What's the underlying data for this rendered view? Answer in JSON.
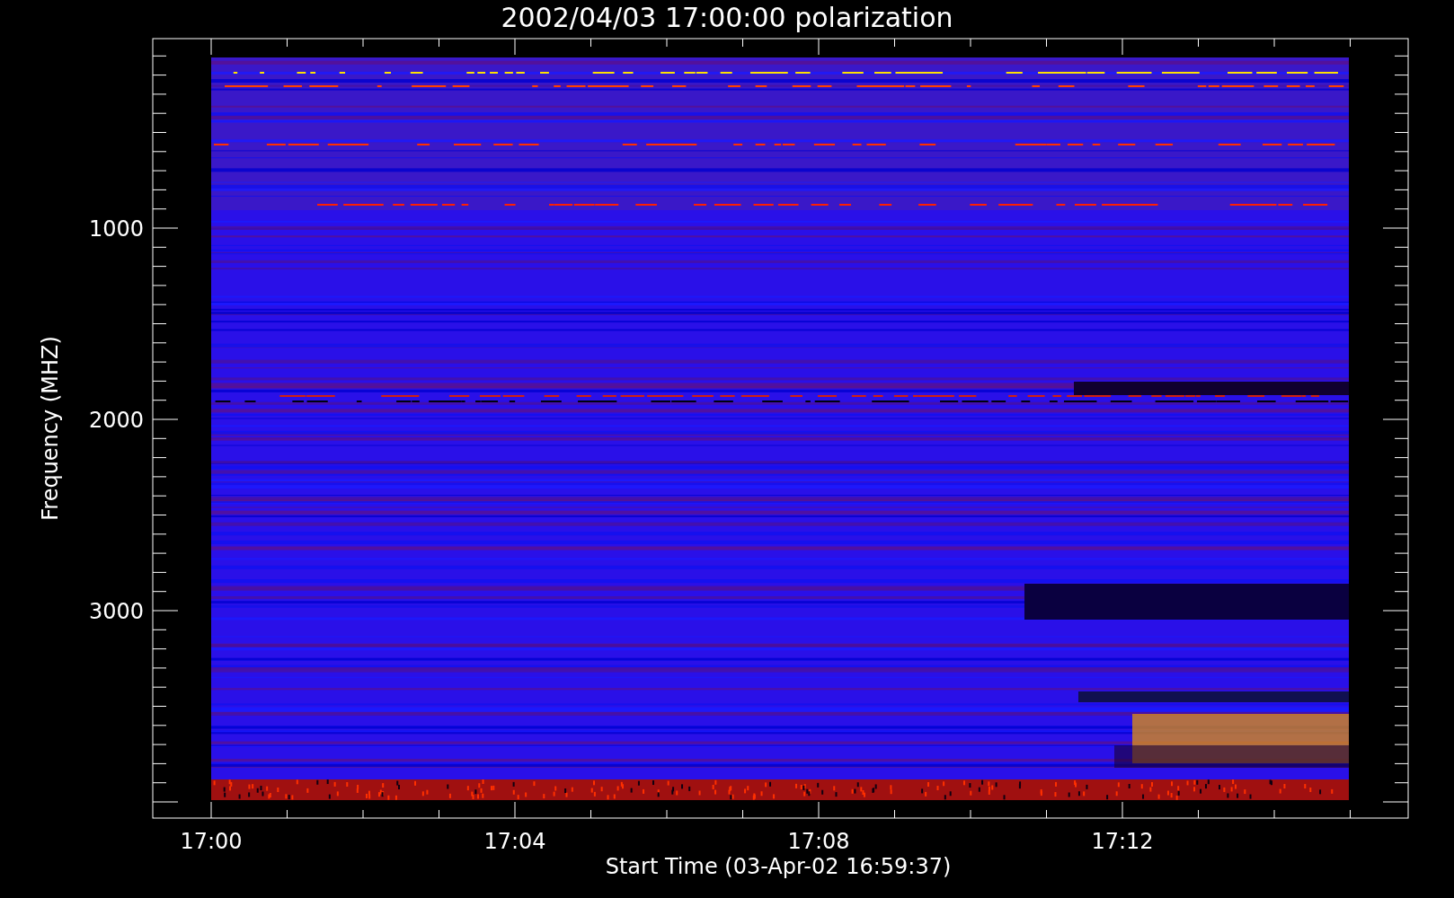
{
  "title": "2002/04/03 17:00:00 polarization",
  "y_axis": {
    "label": "Frequency (MHZ)",
    "ticks": [
      "1000",
      "2000",
      "3000"
    ]
  },
  "x_axis": {
    "label": "Start Time (03-Apr-02 16:59:37)",
    "ticks": [
      "17:00",
      "17:04",
      "17:08",
      "17:12"
    ]
  }
}
